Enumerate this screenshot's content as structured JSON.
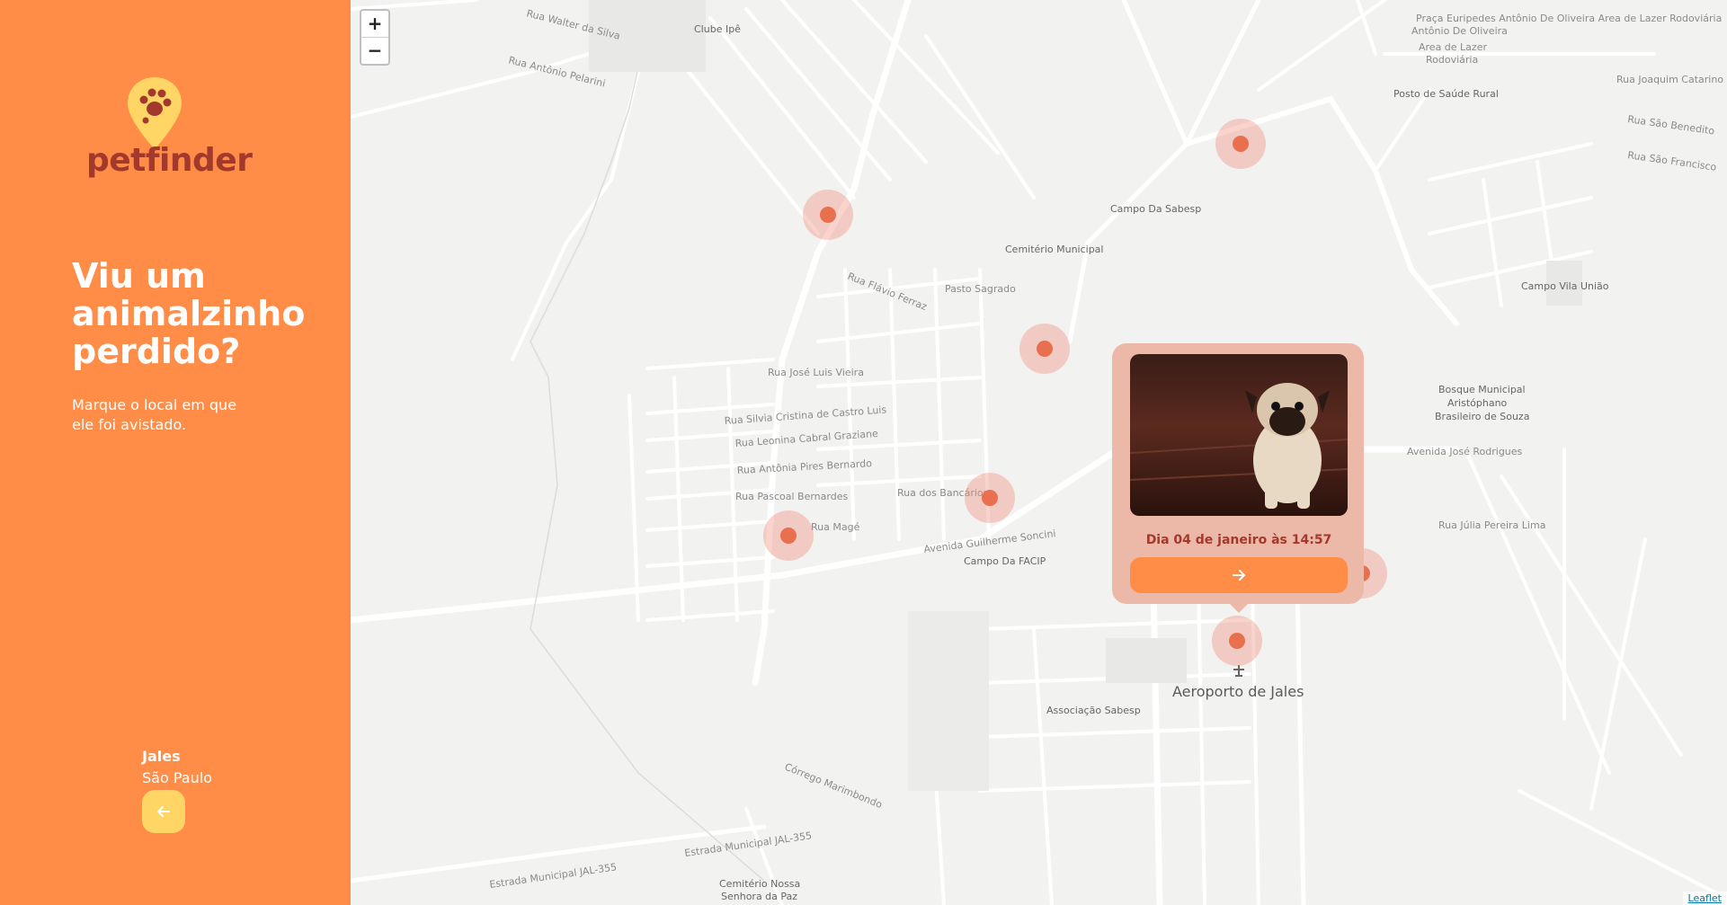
{
  "sidebar": {
    "logo_text": "petfinder",
    "headline": "Viu um animalzinho perdido?",
    "subtitle": "Marque o local em que ele foi avistado.",
    "city": "Jales",
    "state": "São Paulo",
    "back_icon": "arrow-left-icon"
  },
  "colors": {
    "sidebar_bg": "#ff8c47",
    "accent": "#ff8c47",
    "brand_dark": "#a3392c",
    "pin": "#e8704f",
    "back_button": "#ffd666"
  },
  "map": {
    "zoom_in": "+",
    "zoom_out": "−",
    "attribution": "Leaflet",
    "labels": {
      "airport": "Aeroporto de Jales",
      "clube": "Clube Ipê",
      "praca": "Praça Euripedes Antônio De Oliveira Area de Lazer Rodoviária",
      "posto": "Posto de Saúde Rural",
      "sabesp": "Campo Da Sabesp",
      "cemiterio": "Cemitério Municipal",
      "pasto": "Pasto Sagrado",
      "bosque1": "Bosque Municipal",
      "bosque2": "Aristóphano",
      "bosque3": "Brasileiro de Souza",
      "campo_vila": "Campo Vila União",
      "campo_facip": "Campo Da FACIP",
      "assoc": "Associação Sabesp",
      "cemit_nossa1": "Cemitério Nossa",
      "cemit_nossa2": "Senhora da Paz",
      "jose_rodrigues": "Avenida José Rodrigues",
      "julia": "Rua Júlia Pereira Lima",
      "joaquim": "Rua Joaquim Catarino",
      "benedito": "Rua São Benedito",
      "francisco": "Rua São Francisco",
      "walter": "Rua Walter da Silva",
      "antonio": "Rua Antônio Pelarini",
      "jose_luis": "Rua José Luis Vieira",
      "silvia": "Rua Silvia Cristina de Castro Luis",
      "leonina": "Rua Leonina Cabral Graziane",
      "antonia": "Rua Antônia Pires Bernardo",
      "pascoal": "Rua Pascoal Bernardes",
      "mage": "Rua Magé",
      "bancarios": "Rua dos Bancários",
      "guilherme": "Avenida Guilherme Soncini",
      "flavio": "Rua Flávio Ferraz",
      "corrego": "Córrego Marimbondo",
      "estrada1": "Estrada Municipal JAL-355",
      "estrada2": "Estrada Municipal JAL-355"
    }
  },
  "popup": {
    "date": "Dia 04 de janeiro às 14:57",
    "photo_alt": "pug-photo",
    "go_icon": "arrow-right-icon"
  }
}
